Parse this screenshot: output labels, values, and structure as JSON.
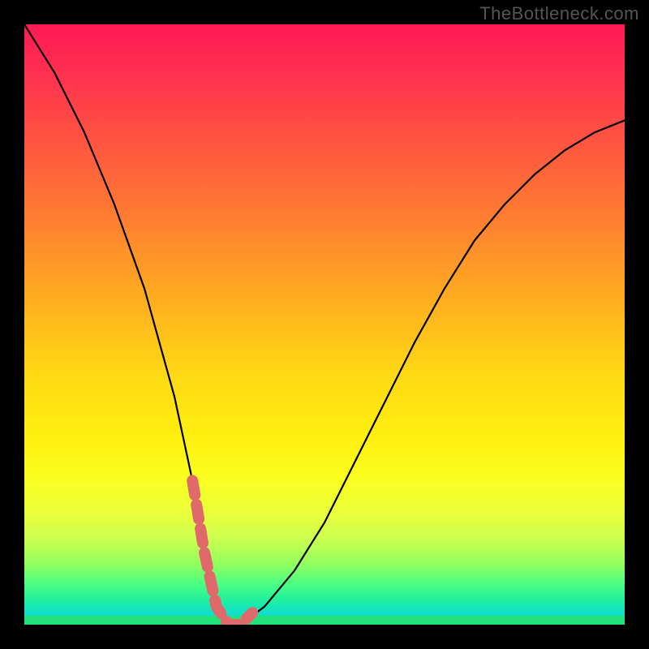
{
  "watermark": "TheBottleneck.com",
  "chart_data": {
    "type": "line",
    "title": "",
    "xlabel": "",
    "ylabel": "",
    "xlim": [
      0,
      100
    ],
    "ylim": [
      0,
      100
    ],
    "background": {
      "style": "vertical-gradient",
      "top_color": "#ff1a55",
      "mid_color": "#ffee10",
      "bottom_color": "#23e27b"
    },
    "series": [
      {
        "name": "curve",
        "x": [
          0,
          5,
          10,
          15,
          20,
          25,
          28,
          30,
          32,
          34,
          36,
          40,
          45,
          50,
          55,
          60,
          65,
          70,
          75,
          80,
          85,
          90,
          95,
          100
        ],
        "y": [
          100,
          92,
          82,
          70,
          56,
          38,
          24,
          12,
          3,
          0,
          0,
          3,
          9,
          17,
          27,
          37,
          47,
          56,
          64,
          70,
          75,
          79,
          82,
          84
        ]
      }
    ],
    "highlight": {
      "name": "bottom-segment",
      "x": [
        28,
        30,
        32,
        34,
        36,
        38
      ],
      "y": [
        24,
        12,
        3,
        0,
        0,
        2
      ],
      "color": "#e06a6a",
      "style": "dashed"
    }
  }
}
